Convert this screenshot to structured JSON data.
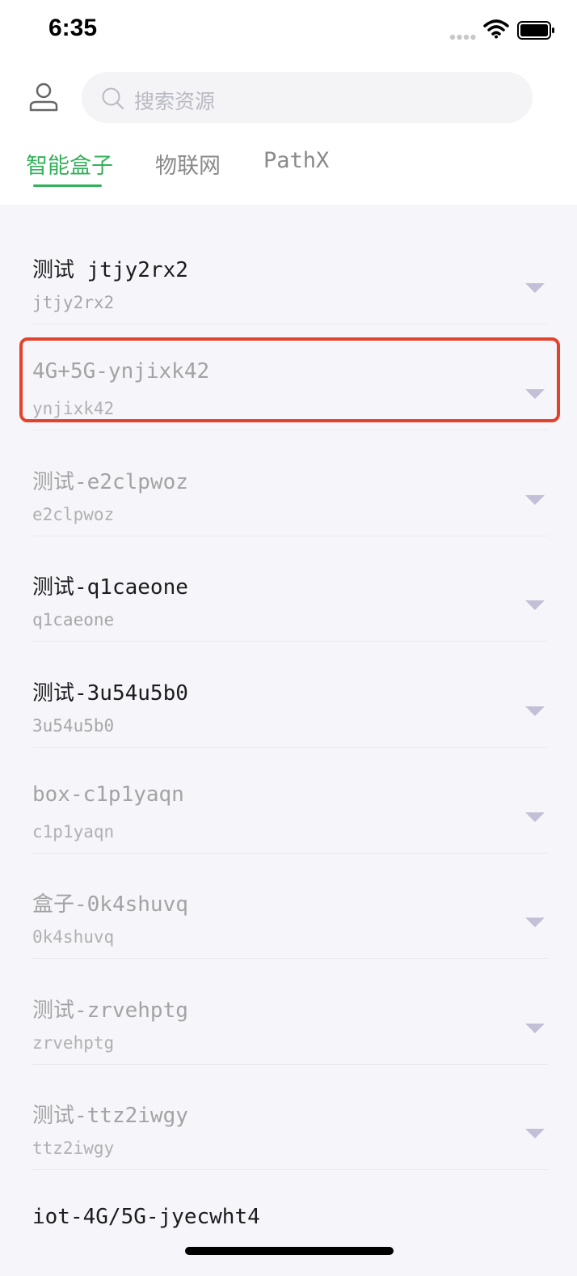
{
  "status_bar": {
    "time": "6:35"
  },
  "search": {
    "placeholder": "搜索资源"
  },
  "tabs": [
    {
      "label": "智能盒子",
      "active": true
    },
    {
      "label": "物联网",
      "active": false
    },
    {
      "label": "PathX",
      "active": false
    }
  ],
  "devices": [
    {
      "title": "测试 jtjy2rx2",
      "id": "jtjy2rx2",
      "online": true
    },
    {
      "title": "4G+5G-ynjixk42",
      "id": "ynjixk42",
      "online": false,
      "highlighted": true
    },
    {
      "title": "测试-e2clpwoz",
      "id": "e2clpwoz",
      "online": false
    },
    {
      "title": "测试-q1caeone",
      "id": "q1caeone",
      "online": true
    },
    {
      "title": "测试-3u54u5b0",
      "id": "3u54u5b0",
      "online": true
    },
    {
      "title": "box-c1p1yaqn",
      "id": "c1p1yaqn",
      "online": false
    },
    {
      "title": "盒子-0k4shuvq",
      "id": "0k4shuvq",
      "online": false
    },
    {
      "title": "测试-zrvehptg",
      "id": "zrvehptg",
      "online": false
    },
    {
      "title": "测试-ttz2iwgy",
      "id": "ttz2iwgy",
      "online": false
    },
    {
      "title": "iot-4G/5G-jyecwht4",
      "id": "",
      "online": true
    }
  ],
  "colors": {
    "accent": "#34b15a",
    "highlight": "#e2432e",
    "caret": "#c2bfd6"
  },
  "icons": [
    "avatar-icon",
    "search-icon",
    "caret-down-icon",
    "wifi-icon",
    "battery-icon",
    "signal-icon"
  ]
}
